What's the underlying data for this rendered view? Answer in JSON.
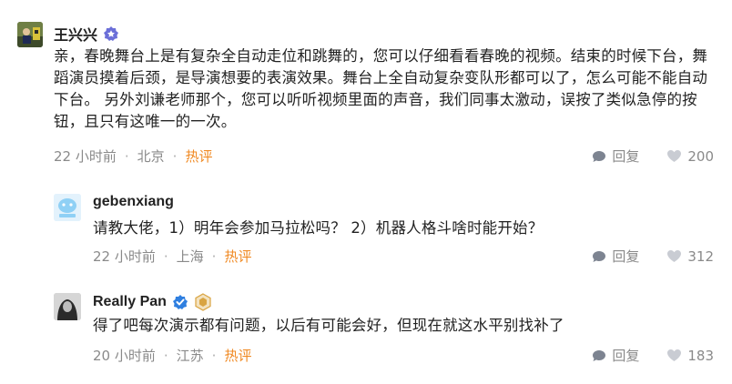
{
  "comments": [
    {
      "username": "王兴兴",
      "text": "亲，春晚舞台上是有复杂全自动走位和跳舞的，您可以仔细看看春晚的视频。结束的时候下台，舞蹈演员摸着后颈，是导演想要的表演效果。舞台上全自动复杂变队形都可以了，怎么可能不能自动下台。 另外刘谦老师那个，您可以听听视频里面的声音，我们同事太激动，误按了类似急停的按钮，且只有这唯一的一次。",
      "time": "22 小时前",
      "location": "北京",
      "hot": "热评",
      "reply_label": "回复",
      "likes": "200"
    },
    {
      "username": "gebenxiang",
      "text": "请教大佬，1）明年会参加马拉松吗？ 2）机器人格斗啥时能开始？",
      "time": "22 小时前",
      "location": "上海",
      "hot": "热评",
      "reply_label": "回复",
      "likes": "312"
    },
    {
      "username": "Really Pan",
      "text": "得了吧每次演示都有问题，以后有可能会好，但现在就这水平别找补了",
      "time": "20 小时前",
      "location": "江苏",
      "hot": "热评",
      "reply_label": "回复",
      "likes": "183"
    }
  ],
  "colors": {
    "text": "#222222",
    "meta": "#8a8a8a",
    "hot": "#f08a24",
    "verified_blue": "#2f7fe0",
    "level_badge": "#d9a441"
  }
}
